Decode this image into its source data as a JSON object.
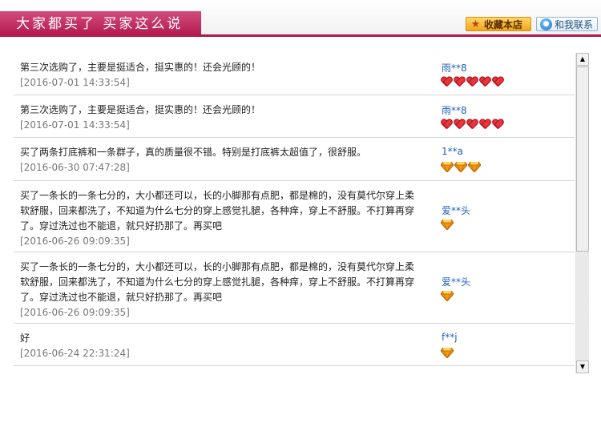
{
  "header": {
    "title": "大家都买了   买家这么说",
    "favorite_label": "收藏本店",
    "contact_label": "和我联系"
  },
  "reviews": [
    {
      "text": "第三次选购了，主要是挺适合，挺实惠的！还会光顾的！",
      "date": "[2016-07-01 14:33:54]",
      "user": "雨**8",
      "badge": "heart",
      "badge_count": 5
    },
    {
      "text": "第三次选购了，主要是挺适合，挺实惠的！还会光顾的！",
      "date": "[2016-07-01 14:33:54]",
      "user": "雨**8",
      "badge": "heart",
      "badge_count": 5
    },
    {
      "text": "买了两条打底裤和一条群子，真的质量很不错。特别是打底裤太超值了，很舒服。",
      "date": "[2016-06-30 07:47:28]",
      "user": "1**a",
      "badge": "diamond",
      "badge_count": 3
    },
    {
      "text": "买了一条长的一条七分的，大小都还可以，长的小脚那有点肥，都是棉的，没有莫代尔穿上柔软舒服，回来都洗了，不知道为什么七分的穿上感觉扎腿，各种痒，穿上不舒服。不打算再穿了。穿过洗过也不能退，就只好扔那了。再买吧",
      "date": "[2016-06-26 09:09:35]",
      "user": "爱**头",
      "badge": "diamond",
      "badge_count": 1
    },
    {
      "text": "买了一条长的一条七分的，大小都还可以，长的小脚那有点肥，都是棉的，没有莫代尔穿上柔软舒服，回来都洗了，不知道为什么七分的穿上感觉扎腿，各种痒，穿上不舒服。不打算再穿了。穿过洗过也不能退，就只好扔那了。再买吧",
      "date": "[2016-06-26 09:09:35]",
      "user": "爱**头",
      "badge": "diamond",
      "badge_count": 1
    },
    {
      "text": "好",
      "date": "[2016-06-24 22:31:24]",
      "user": "f**j",
      "badge": "diamond",
      "badge_count": 1
    }
  ],
  "icons": {
    "favorite": "star-icon",
    "contact": "chat-icon",
    "heart_badge": "heart-icon",
    "diamond_badge": "diamond-icon"
  },
  "colors": {
    "accent": "#b0174c",
    "username": "#1e5fbf",
    "heart": "#e8343c",
    "diamond": "#f29a12"
  }
}
